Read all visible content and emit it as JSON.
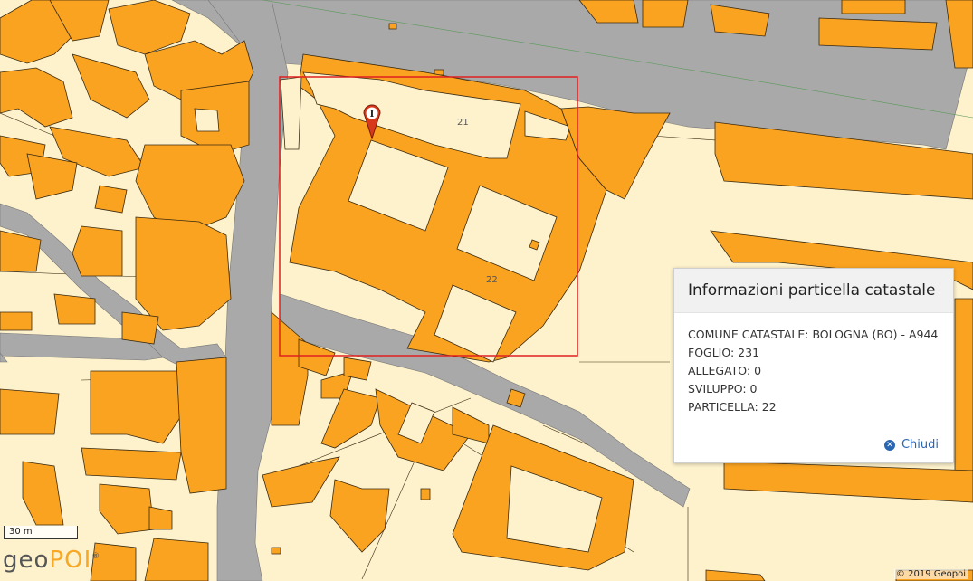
{
  "map": {
    "parcel_labels": [
      "21",
      "22"
    ],
    "selection_color": "#e02020",
    "marker_letter": "I",
    "marker_color": "#d63a1a",
    "colors": {
      "building": "#faa320",
      "land": "#fdf2cc",
      "road": "#a9a9a9"
    }
  },
  "info_panel": {
    "title": "Informazioni particella catastale",
    "lines": [
      "COMUNE CATASTALE: BOLOGNA (BO) - A944",
      "FOGLIO: 231",
      "ALLEGATO: 0",
      "SVILUPPO: 0",
      "PARTICELLA: 22"
    ],
    "close_label": "Chiudi",
    "close_icon": "close-circle-icon"
  },
  "scale_bar": {
    "label": "30 m"
  },
  "logo": {
    "part1": "geo",
    "part2": "POI",
    "mark": "®"
  },
  "copyright": "© 2019 Geopoi"
}
